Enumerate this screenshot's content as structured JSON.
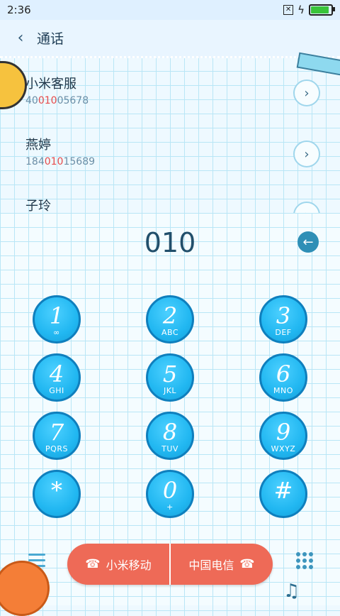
{
  "status_bar": {
    "time": "2:36"
  },
  "header": {
    "title": "通话"
  },
  "contacts": [
    {
      "name": "小米客服",
      "number_prefix": "40",
      "number_match": "010",
      "number_suffix": "05678"
    },
    {
      "name": "燕婷",
      "number_prefix": "184",
      "number_match": "010",
      "number_suffix": "15689"
    },
    {
      "name": "子玲",
      "number_prefix": "",
      "number_match": "",
      "number_suffix": ""
    }
  ],
  "dialer": {
    "display": "010",
    "keys": [
      {
        "digit": "1",
        "letters": ""
      },
      {
        "digit": "2",
        "letters": "ABC"
      },
      {
        "digit": "3",
        "letters": "DEF"
      },
      {
        "digit": "4",
        "letters": "GHI"
      },
      {
        "digit": "5",
        "letters": "JKL"
      },
      {
        "digit": "6",
        "letters": "MNO"
      },
      {
        "digit": "7",
        "letters": "PQRS"
      },
      {
        "digit": "8",
        "letters": "TUV"
      },
      {
        "digit": "9",
        "letters": "WXYZ"
      },
      {
        "digit": "*",
        "letters": ""
      },
      {
        "digit": "0",
        "letters": "+"
      },
      {
        "digit": "#",
        "letters": ""
      }
    ]
  },
  "call_buttons": {
    "sim1_label": "小米移动",
    "sim2_label": "中国电信"
  }
}
